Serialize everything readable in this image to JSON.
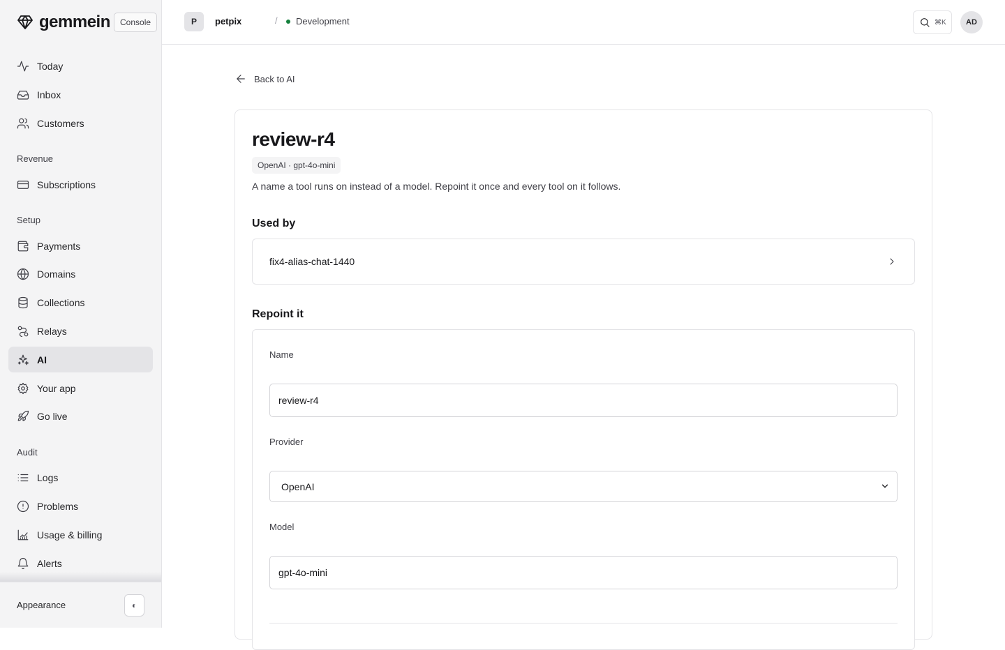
{
  "brand": {
    "name": "gemmein",
    "console_label": "Console"
  },
  "sidebar": {
    "main": [
      {
        "label": "Today",
        "icon": "activity-icon"
      },
      {
        "label": "Inbox",
        "icon": "inbox-icon"
      },
      {
        "label": "Customers",
        "icon": "users-icon"
      }
    ],
    "sections": [
      {
        "title": "Revenue",
        "items": [
          {
            "label": "Subscriptions",
            "icon": "credit-card-icon"
          }
        ]
      },
      {
        "title": "Setup",
        "items": [
          {
            "label": "Payments",
            "icon": "wallet-icon"
          },
          {
            "label": "Domains",
            "icon": "globe-icon"
          },
          {
            "label": "Collections",
            "icon": "database-icon"
          },
          {
            "label": "Relays",
            "icon": "relay-icon"
          },
          {
            "label": "AI",
            "icon": "sparkles-icon",
            "active": true
          },
          {
            "label": "Your app",
            "icon": "gear-icon"
          },
          {
            "label": "Go live",
            "icon": "rocket-icon"
          }
        ]
      },
      {
        "title": "Audit",
        "items": [
          {
            "label": "Logs",
            "icon": "list-icon"
          },
          {
            "label": "Problems",
            "icon": "alert-circle-icon"
          },
          {
            "label": "Usage & billing",
            "icon": "chart-icon"
          },
          {
            "label": "Alerts",
            "icon": "bell-icon"
          }
        ]
      }
    ],
    "appearance_label": "Appearance",
    "theme_toggle_glyph": "◐"
  },
  "topbar": {
    "project_initial": "P",
    "project_name": "petpix",
    "separator": "/",
    "environment": "Development",
    "search_shortcut": "⌘K",
    "user_initials": "AD"
  },
  "page": {
    "back_label": "Back to AI",
    "title": "review-r4",
    "model_badge": "OpenAI · gpt-4o-mini",
    "description": "A name a tool runs on instead of a model. Repoint it once and every tool on it follows.",
    "used_by_heading": "Used by",
    "used_by": [
      "fix4-alias-chat-1440"
    ],
    "repoint_heading": "Repoint it",
    "form": {
      "name_label": "Name",
      "name_value": "review-r4",
      "provider_label": "Provider",
      "provider_value": "OpenAI",
      "model_label": "Model",
      "model_value": "gpt-4o-mini"
    }
  },
  "colors": {
    "sidebar_bg": "#f4f4f5",
    "active_item_bg": "#e4e4e7",
    "border": "#e4e4e7",
    "environment_dot": "#15803d"
  }
}
